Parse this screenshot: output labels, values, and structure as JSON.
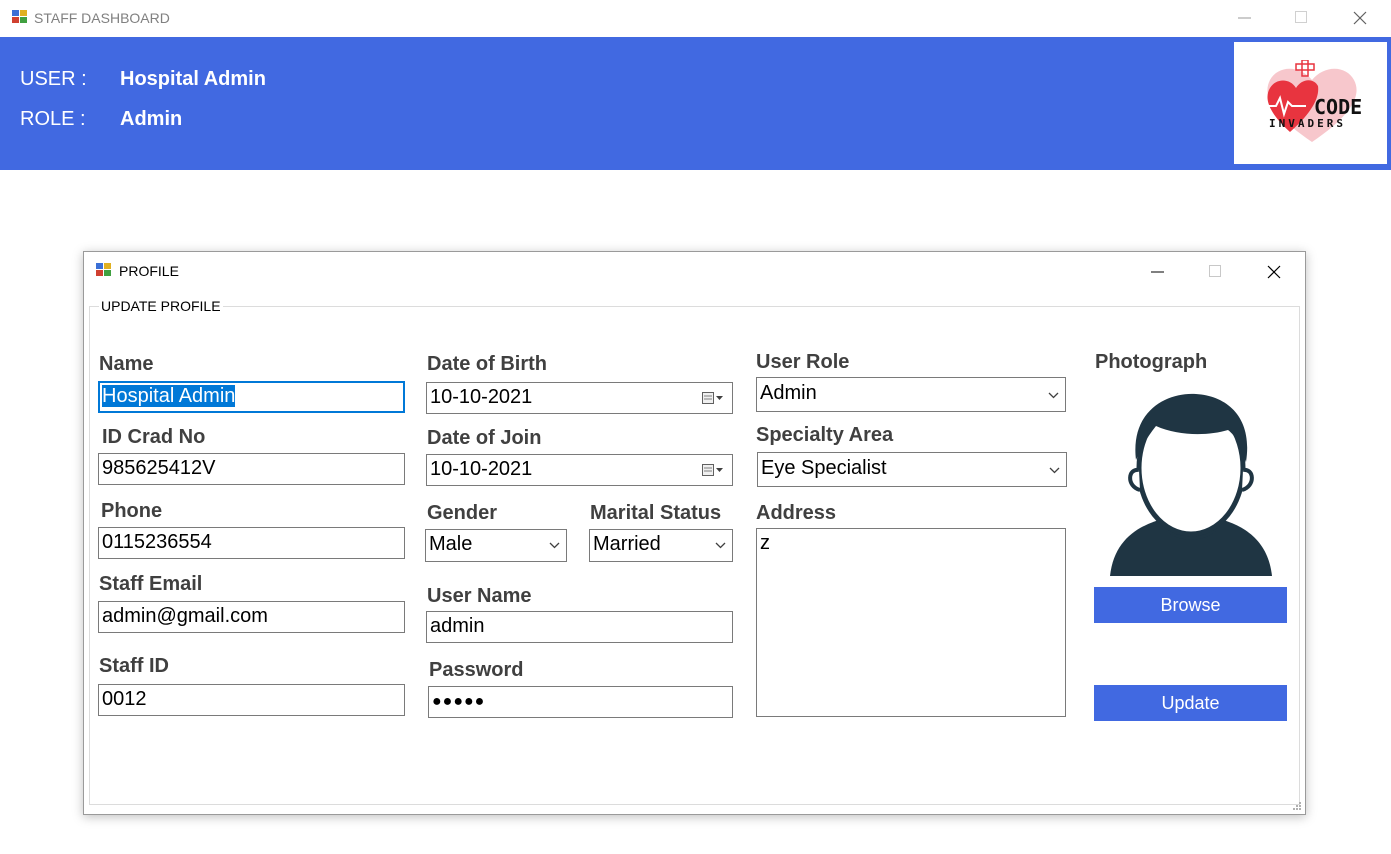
{
  "window": {
    "title": "STAFF DASHBOARD"
  },
  "header": {
    "user_label": "USER :",
    "user_value": "Hospital Admin",
    "role_label": "ROLE :",
    "role_value": "Admin",
    "logo_text_1": "CODE",
    "logo_text_2": "INVADERS"
  },
  "dialog": {
    "title": "PROFILE",
    "group_caption": "UPDATE PROFILE",
    "fields": {
      "name": {
        "label": "Name",
        "value": "Hospital Admin"
      },
      "id_card": {
        "label": "ID Crad No",
        "value": "985625412V"
      },
      "phone": {
        "label": "Phone",
        "value": "0115236554"
      },
      "email": {
        "label": "Staff Email",
        "value": "admin@gmail.com"
      },
      "staff_id": {
        "label": "Staff ID",
        "value": "0012"
      },
      "dob": {
        "label": "Date of Birth",
        "value": "10-10-2021"
      },
      "doj": {
        "label": "Date of Join",
        "value": "10-10-2021"
      },
      "gender": {
        "label": "Gender",
        "value": "Male"
      },
      "marital": {
        "label": "Marital Status",
        "value": "Married"
      },
      "username": {
        "label": "User Name",
        "value": "admin"
      },
      "password": {
        "label": "Password",
        "value": "●●●●●"
      },
      "role": {
        "label": "User Role",
        "value": "Admin"
      },
      "specialty": {
        "label": "Specialty Area",
        "value": "Eye Specialist"
      },
      "address": {
        "label": "Address",
        "value": "z"
      }
    },
    "photograph_label": "Photograph",
    "browse_label": "Browse",
    "update_label": "Update"
  },
  "colors": {
    "accent": "#4169e1",
    "focus": "#0078d7",
    "avatar": "#1f3543"
  },
  "icons": [
    "app-icon",
    "minimize-icon",
    "maximize-icon",
    "close-icon",
    "calendar-icon",
    "chevron-down-icon",
    "avatar-icon",
    "resize-grip-icon"
  ]
}
